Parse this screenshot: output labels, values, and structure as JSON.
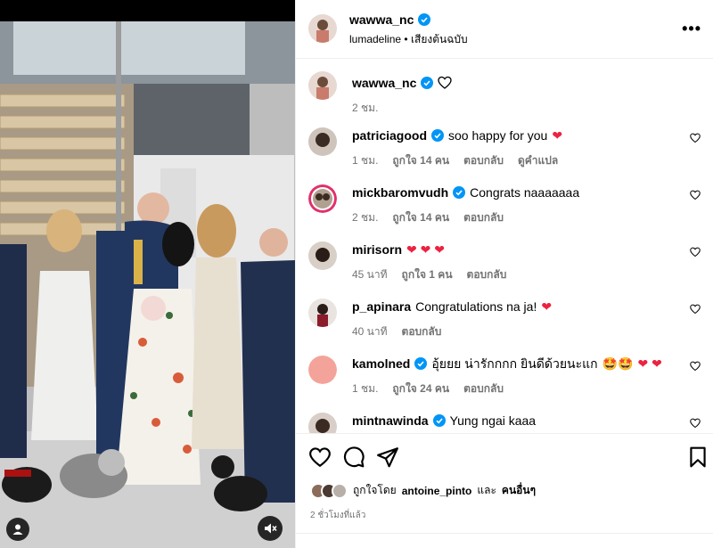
{
  "post": {
    "username": "wawwa_nc",
    "audio_user": "lumadeline",
    "audio_label": "เสียงต้นฉบับ",
    "more_label": "•••",
    "caption_time": "2 ชม."
  },
  "comments": [
    {
      "user": "patriciagood",
      "verified": true,
      "text": "soo happy for you",
      "hearts": 1,
      "emoji": "",
      "time": "1 ชม.",
      "likes": "ถูกใจ 14 คน",
      "reply": "ตอบกลับ",
      "translate": "ดูคำแปล"
    },
    {
      "user": "mickbaromvudh",
      "verified": true,
      "text": "Congrats naaaaaaa",
      "hearts": 0,
      "emoji": "",
      "time": "2 ชม.",
      "likes": "ถูกใจ 14 คน",
      "reply": "ตอบกลับ",
      "translate": ""
    },
    {
      "user": "mirisorn",
      "verified": false,
      "text": "",
      "hearts": 3,
      "emoji": "",
      "time": "45 นาที",
      "likes": "ถูกใจ 1 คน",
      "reply": "ตอบกลับ",
      "translate": ""
    },
    {
      "user": "p_apinara",
      "verified": false,
      "text": "Congratulations na ja!",
      "hearts": 1,
      "emoji": "",
      "time": "40 นาที",
      "likes": "",
      "reply": "ตอบกลับ",
      "translate": ""
    },
    {
      "user": "kamolned",
      "verified": true,
      "text": "อุ้ยยย น่ารักกกก ยินดีด้วยนะแก",
      "hearts": 2,
      "emoji": "🤩🤩",
      "time": "1 ชม.",
      "likes": "ถูกใจ 24 คน",
      "reply": "ตอบกลับ",
      "translate": ""
    },
    {
      "user": "mintnawinda",
      "verified": true,
      "text": "Yung ngai kaaa",
      "hearts": 0,
      "emoji": "",
      "time": "",
      "likes": "",
      "reply": "",
      "translate": ""
    }
  ],
  "likes_line": {
    "prefix": "ถูกใจโดย",
    "user": "antoine_pinto",
    "joiner": "และ",
    "others": "คนอื่นๆ"
  },
  "post_time": "2 ชั่วโมงที่แล้ว",
  "colors": {
    "verified": "#0095f6",
    "heart": "#ed2140",
    "meta": "#737373"
  }
}
